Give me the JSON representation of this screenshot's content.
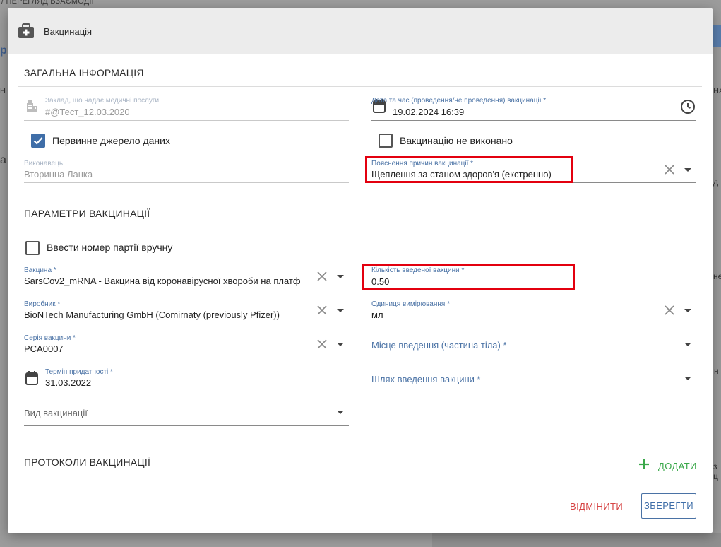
{
  "background": {
    "breadcrumb": "/ ПЕРЕГЛЯД ВЗАЄМОДІЇ",
    "left_fragment_p": "р",
    "left_fragment_n": "Н",
    "left_fragment_a": "а",
    "right_fragment_na": "НА",
    "right_fragment_d": "д",
    "right_fragment_ne": "не",
    "right_fragment_n": "н",
    "right_fragment_c": "з ц"
  },
  "dialog": {
    "title": "Вакцинація",
    "title_icon": "medical-briefcase-icon"
  },
  "general": {
    "section_title": "ЗАГАЛЬНА ІНФОРМАЦІЯ",
    "facility": {
      "label": "Заклад, що надає медичні послуги",
      "value": "#@Тест_12.03.2020",
      "icon": "building-icon"
    },
    "datetime": {
      "label": "Дата та час (проведення/не проведення) вакцинації *",
      "value": "19.02.2024 16:39",
      "icon": "calendar-icon",
      "trailing_icon": "clock-icon"
    },
    "primary_source": {
      "label": "Первинне джерело даних",
      "checked": true
    },
    "not_done": {
      "label": "Вакцинацію не виконано",
      "checked": false
    },
    "performer": {
      "label": "Виконавець",
      "value": "Вторинна Ланка"
    },
    "reason": {
      "label": "Пояснення причин вакцинації *",
      "value": "Щеплення за станом здоров'я (екстренно)"
    }
  },
  "params": {
    "section_title": "ПАРАМЕТРИ ВАКЦИНАЦІЇ",
    "manual_lot": {
      "label": "Ввести номер партії вручну",
      "checked": false
    },
    "vaccine": {
      "label": "Вакцина *",
      "value": "SarsCov2_mRNA - Вакцина від коронавірусної хвороби на платф"
    },
    "dose_quantity": {
      "label": "Кількість введеної вакцини *",
      "value": "0.50"
    },
    "manufacturer": {
      "label": "Виробник *",
      "value": "BioNTech Manufacturing GmbH (Comirnaty (previously Pfizer))"
    },
    "unit": {
      "label": "Одиниця вимірювання *",
      "value": "мл"
    },
    "lot": {
      "label": "Серія вакцини *",
      "value": "PCA0007"
    },
    "site": {
      "placeholder": "Місце введення (частина тіла) *"
    },
    "expiration": {
      "label": "Термін придатності *",
      "value": "31.03.2022",
      "icon": "calendar-icon"
    },
    "route": {
      "placeholder": "Шлях введення вакцини *"
    },
    "vaccination_type": {
      "placeholder": "Вид вакцинації"
    }
  },
  "protocols": {
    "section_title": "ПРОТОКОЛИ ВАКЦИНАЦІЇ",
    "add_label": "ДОДАТИ",
    "add_icon": "plus-icon"
  },
  "actions": {
    "cancel_label": "ВІДМІНИТИ",
    "save_label": "ЗБЕРЕГТИ"
  },
  "colors": {
    "accent": "#3f6ea8",
    "label": "#4a72a5",
    "highlight": "#e3000f",
    "add": "#3aa84a",
    "cancel": "#d64545"
  }
}
